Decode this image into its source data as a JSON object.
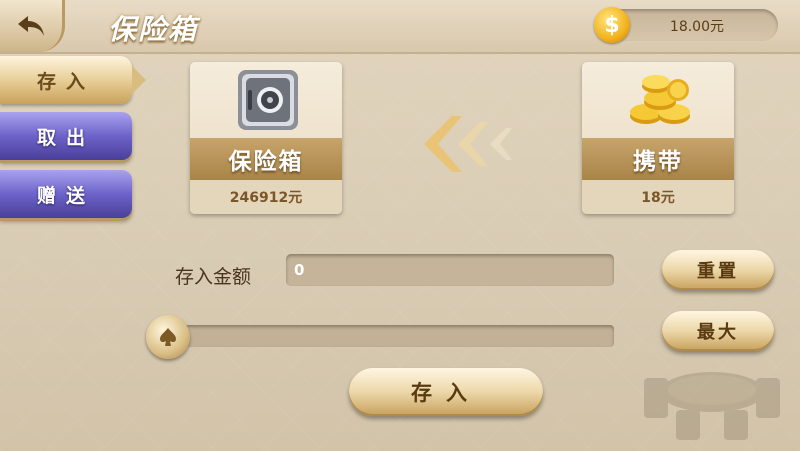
{
  "header": {
    "title": "保险箱",
    "balance": "18.00元",
    "coin_symbol": "$"
  },
  "tabs": [
    {
      "label": "存入",
      "active": true
    },
    {
      "label": "取出",
      "active": false
    },
    {
      "label": "赠送",
      "active": false
    }
  ],
  "safe_card": {
    "title": "保险箱",
    "amount": "246912元"
  },
  "carry_card": {
    "title": "携带",
    "amount": "18元"
  },
  "deposit": {
    "amount_label": "存入金额",
    "amount_value": "0",
    "slider_fraction": 0,
    "reset_label": "重置",
    "max_label": "最大",
    "submit_label": "存入"
  },
  "colors": {
    "accent_gold": "#c9a25b",
    "tab_purple": "#6d63c9",
    "background": "#dccfb7"
  }
}
